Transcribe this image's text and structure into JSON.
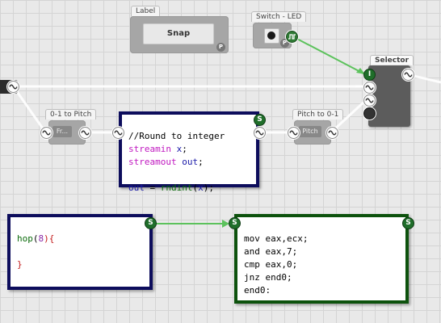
{
  "modules": {
    "label": {
      "title": "Label",
      "button_text": "Snap",
      "badge": "P"
    },
    "switch_led": {
      "title": "Switch - LED",
      "badge": "P"
    },
    "zero_to_pitch": {
      "title": "0-1 to Pitch",
      "inner_label": "Fr..."
    },
    "pitch_to_zero": {
      "title": "Pitch to 0-1",
      "inner_label": "Pitch"
    },
    "selector": {
      "title": "Selector",
      "port_letter": "I"
    },
    "script_round": {
      "port_letter": "S",
      "line1": "//Round to integer",
      "line2_kw": "streamin",
      "line2_var": "x",
      "line2_end": ";",
      "line3_kw": "streamout",
      "line3_var": "out",
      "line3_end": ";",
      "line5_var": "out",
      "line5_op": " = ",
      "line5_fn": "rndint",
      "line5_open": "(",
      "line5_arg": "x",
      "line5_close": ");"
    },
    "script_hop": {
      "port_letter": "S",
      "line1_fn": "hop",
      "line1_paren": "(",
      "line1_num": "8",
      "line1_close": "){",
      "line3": "}"
    },
    "script_asm": {
      "port_letter": "S",
      "lines": [
        "mov eax,ecx;",
        "and eax,7;",
        "cmp eax,0;",
        "jnz end0;",
        "end0:"
      ]
    }
  },
  "colors": {
    "wire_green": "#5cc25c",
    "wire_white": "#ffffff",
    "script_border_blue": "#0d0d5c",
    "script_border_green": "#0d520d"
  }
}
